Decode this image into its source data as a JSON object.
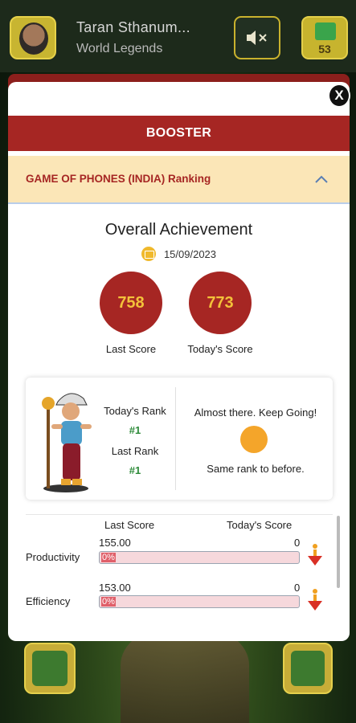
{
  "header": {
    "user_name": "Taran Sthanum...",
    "subtitle": "World Legends",
    "coin_count": "53"
  },
  "modal": {
    "close_label": "X",
    "section_title": "BOOSTER",
    "ranking_label": "GAME OF PHONES (INDIA) Ranking",
    "achievement": {
      "title": "Overall Achievement",
      "date": "15/09/2023",
      "last_score": "758",
      "last_score_label": "Last Score",
      "today_score": "773",
      "today_score_label": "Today's Score"
    },
    "rank": {
      "today_rank_label": "Today's Rank",
      "today_rank": "#1",
      "last_rank_label": "Last Rank",
      "last_rank": "#1",
      "message": "Almost there. Keep Going!",
      "status": "Same rank to before."
    },
    "metrics": {
      "col_last": "Last Score",
      "col_today": "Today's Score",
      "rows": [
        {
          "label": "Productivity",
          "last": "155.00",
          "today": "0",
          "pct": "0%"
        },
        {
          "label": "Efficiency",
          "last": "153.00",
          "today": "0",
          "pct": "0%"
        }
      ]
    }
  },
  "colors": {
    "brand_red": "#a62623",
    "gold": "#f3c13a",
    "rank_green": "#2e8b3a"
  }
}
